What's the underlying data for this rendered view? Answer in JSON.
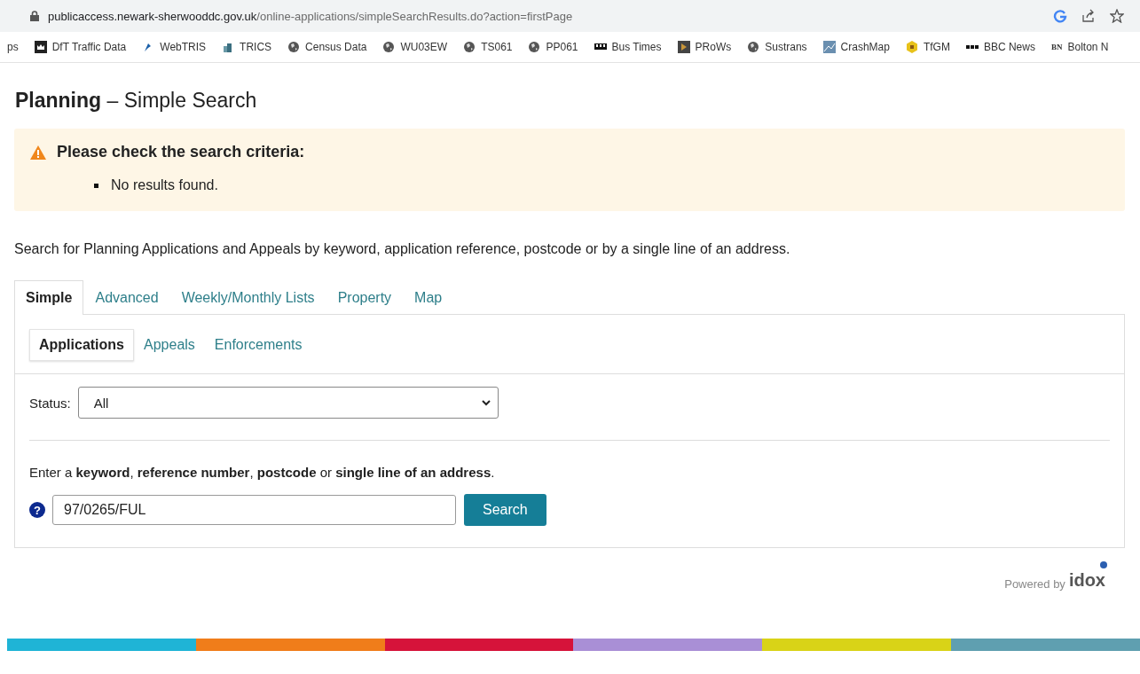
{
  "browser": {
    "url_host": "publicaccess.newark-sherwooddc.gov.uk",
    "url_path": "/online-applications/simpleSearchResults.do?action=firstPage",
    "bookmarks": [
      {
        "label": "ps",
        "kind": "none"
      },
      {
        "label": "DfT Traffic Data",
        "kind": "crown"
      },
      {
        "label": "WebTRIS",
        "kind": "bird"
      },
      {
        "label": "TRICS",
        "kind": "building"
      },
      {
        "label": "Census Data",
        "kind": "globe"
      },
      {
        "label": "WU03EW",
        "kind": "globe"
      },
      {
        "label": "TS061",
        "kind": "globe"
      },
      {
        "label": "PP061",
        "kind": "globe"
      },
      {
        "label": "Bus Times",
        "kind": "bus"
      },
      {
        "label": "PRoWs",
        "kind": "square"
      },
      {
        "label": "Sustrans",
        "kind": "globe"
      },
      {
        "label": "CrashMap",
        "kind": "chart"
      },
      {
        "label": "TfGM",
        "kind": "hex"
      },
      {
        "label": "BBC News",
        "kind": "dots"
      },
      {
        "label": "Bolton N",
        "kind": "bn",
        "icon_text": "BN"
      }
    ]
  },
  "page": {
    "title_bold": "Planning",
    "title_rest": " – Simple Search"
  },
  "alert": {
    "heading": "Please check the search criteria:",
    "items": [
      "No results found."
    ]
  },
  "intro": "Search for Planning Applications and Appeals by keyword, application reference, postcode or by a single line of an address.",
  "tabs": [
    {
      "label": "Simple",
      "selected": true
    },
    {
      "label": "Advanced",
      "selected": false
    },
    {
      "label": "Weekly/Monthly Lists",
      "selected": false
    },
    {
      "label": "Property",
      "selected": false
    },
    {
      "label": "Map",
      "selected": false
    }
  ],
  "subtabs": [
    {
      "label": "Applications",
      "selected": true
    },
    {
      "label": "Appeals",
      "selected": false
    },
    {
      "label": "Enforcements",
      "selected": false
    }
  ],
  "status": {
    "label": "Status:",
    "value": "All"
  },
  "hint": "Enter a **keyword**, **reference number**, **postcode** or **single line of an address**.",
  "search": {
    "help": "?",
    "value": "97/0265/FUL",
    "button": "Search"
  },
  "footer": {
    "powered_by": "Powered by",
    "logo": "idox",
    "stripes": [
      {
        "color": "#1fb4d6"
      },
      {
        "color": "#f07d1a"
      },
      {
        "color": "#d6133a"
      },
      {
        "color": "#a98fd6"
      },
      {
        "color": "#d9d317"
      },
      {
        "color": "#5f9fb0"
      }
    ]
  }
}
